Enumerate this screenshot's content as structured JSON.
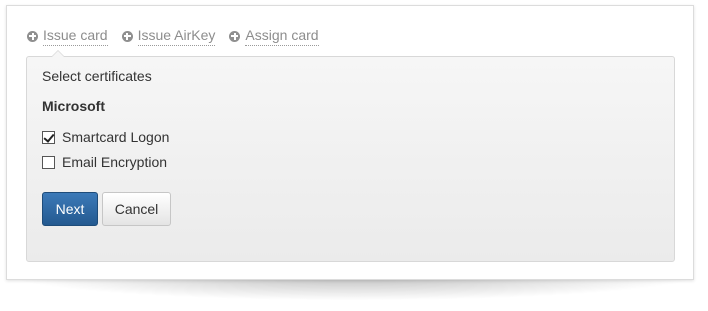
{
  "tabs": [
    {
      "label": "Issue card",
      "icon": "plus-circle-icon"
    },
    {
      "label": "Issue AirKey",
      "icon": "plus-circle-icon"
    },
    {
      "label": "Assign card",
      "icon": "plus-circle-icon"
    }
  ],
  "panel": {
    "title": "Select certificates",
    "group_title": "Microsoft",
    "certificates": [
      {
        "label": "Smartcard Logon",
        "checked": true
      },
      {
        "label": "Email Encryption",
        "checked": false
      }
    ],
    "next_label": "Next",
    "cancel_label": "Cancel"
  },
  "colors": {
    "primary": "#2f6aa5",
    "tab_text": "#8d8d8d",
    "panel_bg": "#efefef"
  }
}
